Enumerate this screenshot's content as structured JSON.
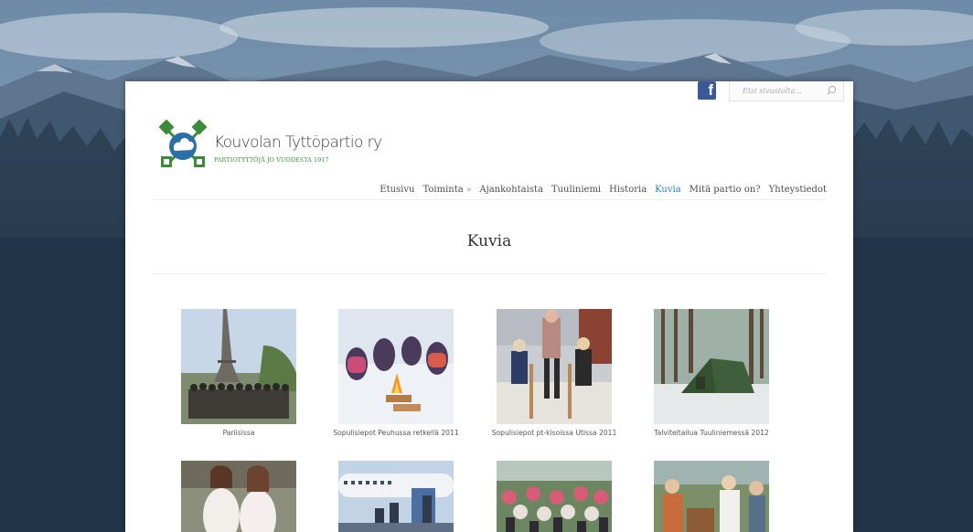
{
  "header": {
    "search_placeholder": "Etsi sivustolta...",
    "facebook_icon": "facebook-icon",
    "search_icon": "search-icon"
  },
  "logo": {
    "title": "Kouvolan Tyttöpartio ry",
    "subtitle": "PARTIOTYTTÖJÄ JO VUODESTA 1917",
    "colors": {
      "green": "#3c8a3a",
      "blue": "#2b6fa8"
    }
  },
  "nav": {
    "items": [
      {
        "label": "Etusivu"
      },
      {
        "label": "Toiminta"
      },
      {
        "label": "Ajankohtaista"
      },
      {
        "label": "Tuuliniemi"
      },
      {
        "label": "Historia"
      },
      {
        "label": "Kuvia"
      },
      {
        "label": "Mitä partio on?"
      },
      {
        "label": "Yhteystiedot"
      }
    ],
    "more_symbol": "»",
    "active_color": "#2a7db4"
  },
  "page": {
    "title": "Kuvia"
  },
  "gallery": {
    "items": [
      {
        "caption": "Pariisissa"
      },
      {
        "caption": "Sopulisiepot Peuhussa retkellä 2011"
      },
      {
        "caption": "Sopulisiepot pt-kisoissa Utissa 2011"
      },
      {
        "caption": "Talviteltailua Tuuliniemessä 2012"
      },
      {
        "caption": ""
      },
      {
        "caption": ""
      },
      {
        "caption": ""
      },
      {
        "caption": ""
      }
    ]
  }
}
